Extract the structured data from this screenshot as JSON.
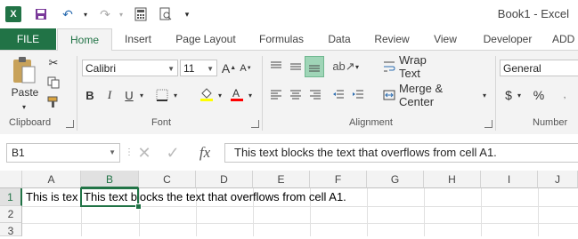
{
  "titlebar": {
    "title": "Book1 - Excel"
  },
  "tabs": [
    {
      "label": "FILE"
    },
    {
      "label": "Home"
    },
    {
      "label": "Insert"
    },
    {
      "label": "Page Layout"
    },
    {
      "label": "Formulas"
    },
    {
      "label": "Data"
    },
    {
      "label": "Review"
    },
    {
      "label": "View"
    },
    {
      "label": "Developer"
    },
    {
      "label": "ADD"
    }
  ],
  "ribbon": {
    "clipboard": {
      "paste_label": "Paste",
      "group_label": "Clipboard"
    },
    "font": {
      "name": "Calibri",
      "size": "11",
      "group_label": "Font",
      "increase": "A",
      "decrease": "A",
      "fill_color": "#ffff00",
      "font_color": "#ff0000"
    },
    "alignment": {
      "wrap_text": "Wrap Text",
      "merge_center": "Merge & Center",
      "group_label": "Alignment"
    },
    "number": {
      "format": "General",
      "currency": "$",
      "percent": "%",
      "group_label": "Number"
    }
  },
  "formula_bar": {
    "name_box": "B1",
    "fx": "fx",
    "formula": "This text blocks the text that overflows from cell A1."
  },
  "grid": {
    "columns": [
      "A",
      "B",
      "C",
      "D",
      "E",
      "F",
      "G",
      "H",
      "I",
      "J"
    ],
    "rows": [
      "1",
      "2",
      "3"
    ],
    "selected_column": "B",
    "cells": {
      "A1": "This is tex",
      "B1": "This text blocks the text that overflows from cell A1."
    }
  }
}
